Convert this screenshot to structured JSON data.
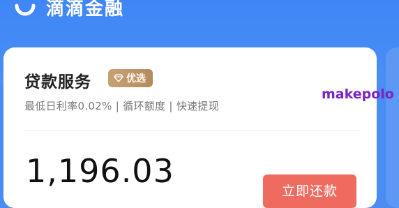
{
  "brand": {
    "name": "滴滴金融",
    "logo_icon": "didi-logo-icon"
  },
  "card": {
    "title": "贷款服务",
    "badge": {
      "label": "优选",
      "icon": "diamond-icon"
    },
    "subtitle": "最低日利率0.02% | 循环额度 | 快速提现",
    "amount": "1,196.03",
    "repay_label": "立即还款"
  },
  "watermark": "makepolo",
  "colors": {
    "header_blue": "#3f86f7",
    "badge_gold": "#c7a175",
    "repay_red": "#ef6b5f",
    "watermark_purple": "#7a24c4"
  }
}
